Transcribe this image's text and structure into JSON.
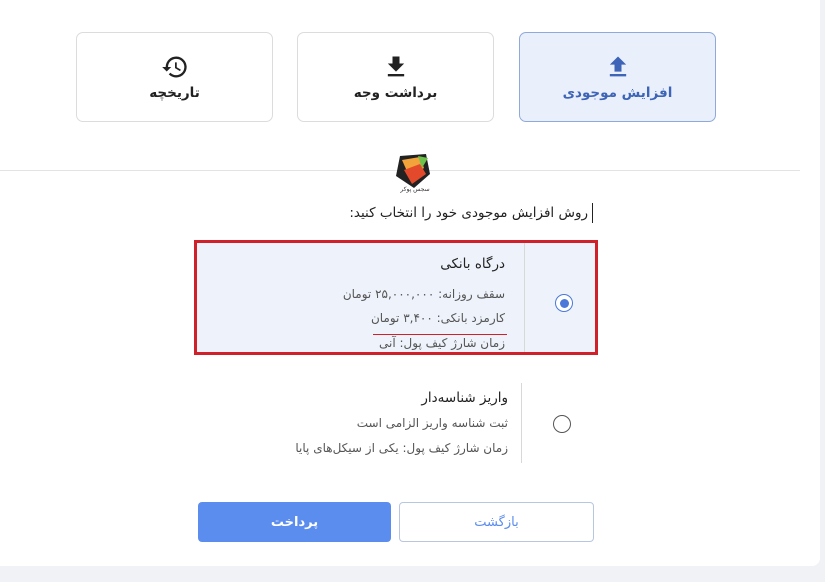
{
  "tabs": [
    {
      "label": "تاریخچه",
      "icon": "history-icon",
      "active": false
    },
    {
      "label": "برداشت وجه",
      "icon": "download-icon",
      "active": false
    },
    {
      "label": "افزایش موجودی",
      "icon": "upload-icon",
      "active": true
    }
  ],
  "logo": {
    "caption": "سجس پوکر",
    "icon": "brand-logo-icon"
  },
  "prompt": "روش افزایش موجودی خود را انتخاب کنید:",
  "options": [
    {
      "title": "درگاه بانکی",
      "line1": "سقف روزانه: ۲۵,۰۰۰,۰۰۰ تومان",
      "line2": "کارمزد بانکی: ۳,۴۰۰ تومان",
      "line3": "زمان شارژ کیف پول: آنی",
      "selected": true
    },
    {
      "title": "واریز شناسه‌دار",
      "line1": "ثبت شناسه واریز الزامی است",
      "line2": "زمان شارژ کیف پول: یکی از سیکل‌های پایا",
      "selected": false
    }
  ],
  "buttons": {
    "pay": "پرداخت",
    "back": "بازگشت"
  },
  "colors": {
    "accent": "#5b8def",
    "active_tab_bg": "#eaf0fb",
    "highlight_border": "#d0202a"
  }
}
